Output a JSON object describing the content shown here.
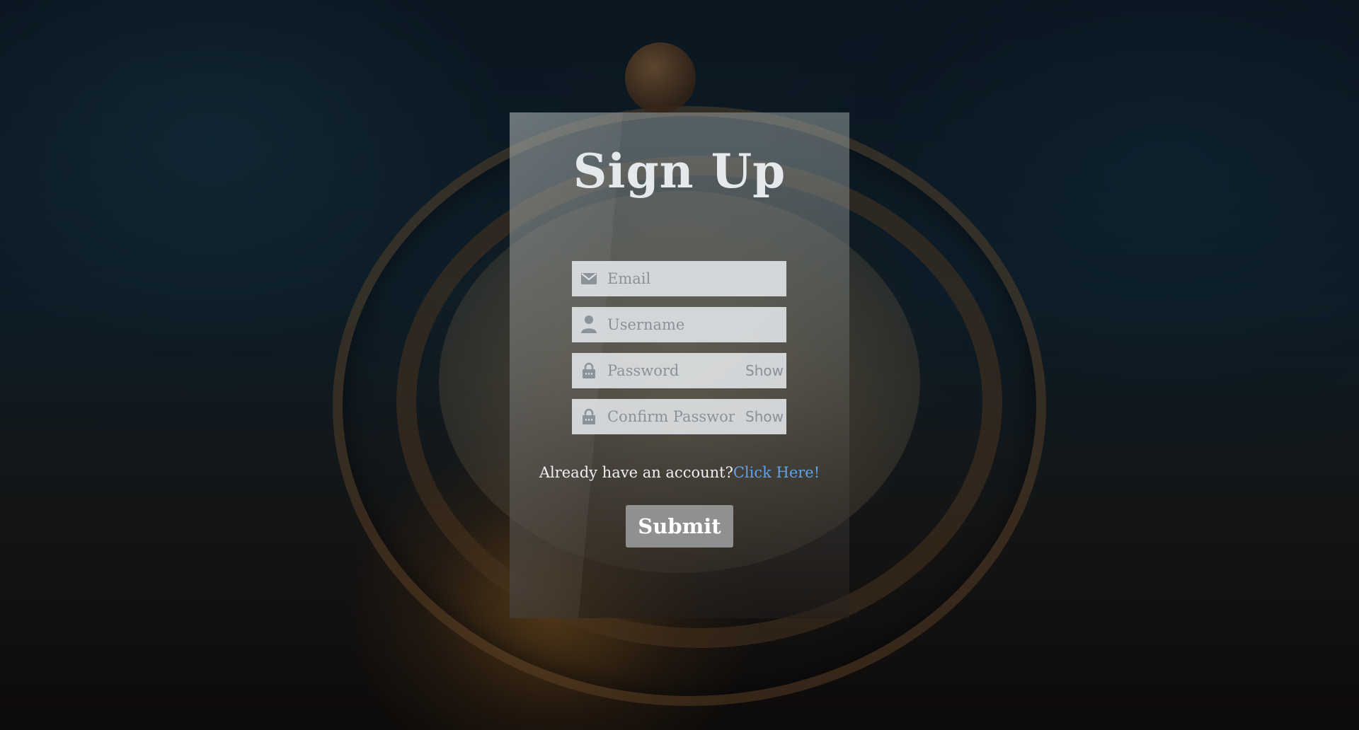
{
  "form": {
    "title": "Sign Up",
    "fields": [
      {
        "name": "email",
        "placeholder": "Email",
        "icon": "envelope-icon"
      },
      {
        "name": "username",
        "placeholder": "Username",
        "icon": "user-icon"
      },
      {
        "name": "password",
        "placeholder": "Password",
        "icon": "lock-icon",
        "toggle_label": "Show"
      },
      {
        "name": "confirm_password",
        "placeholder": "Confirm Password",
        "icon": "lock-icon",
        "toggle_label": "Show"
      }
    ],
    "login_prompt": "Already have an account?",
    "login_link": "Click Here!",
    "submit_label": "Submit"
  },
  "colors": {
    "link": "#5fa2e6",
    "field_background": "#e4e7eb",
    "submit_background": "#969696"
  }
}
